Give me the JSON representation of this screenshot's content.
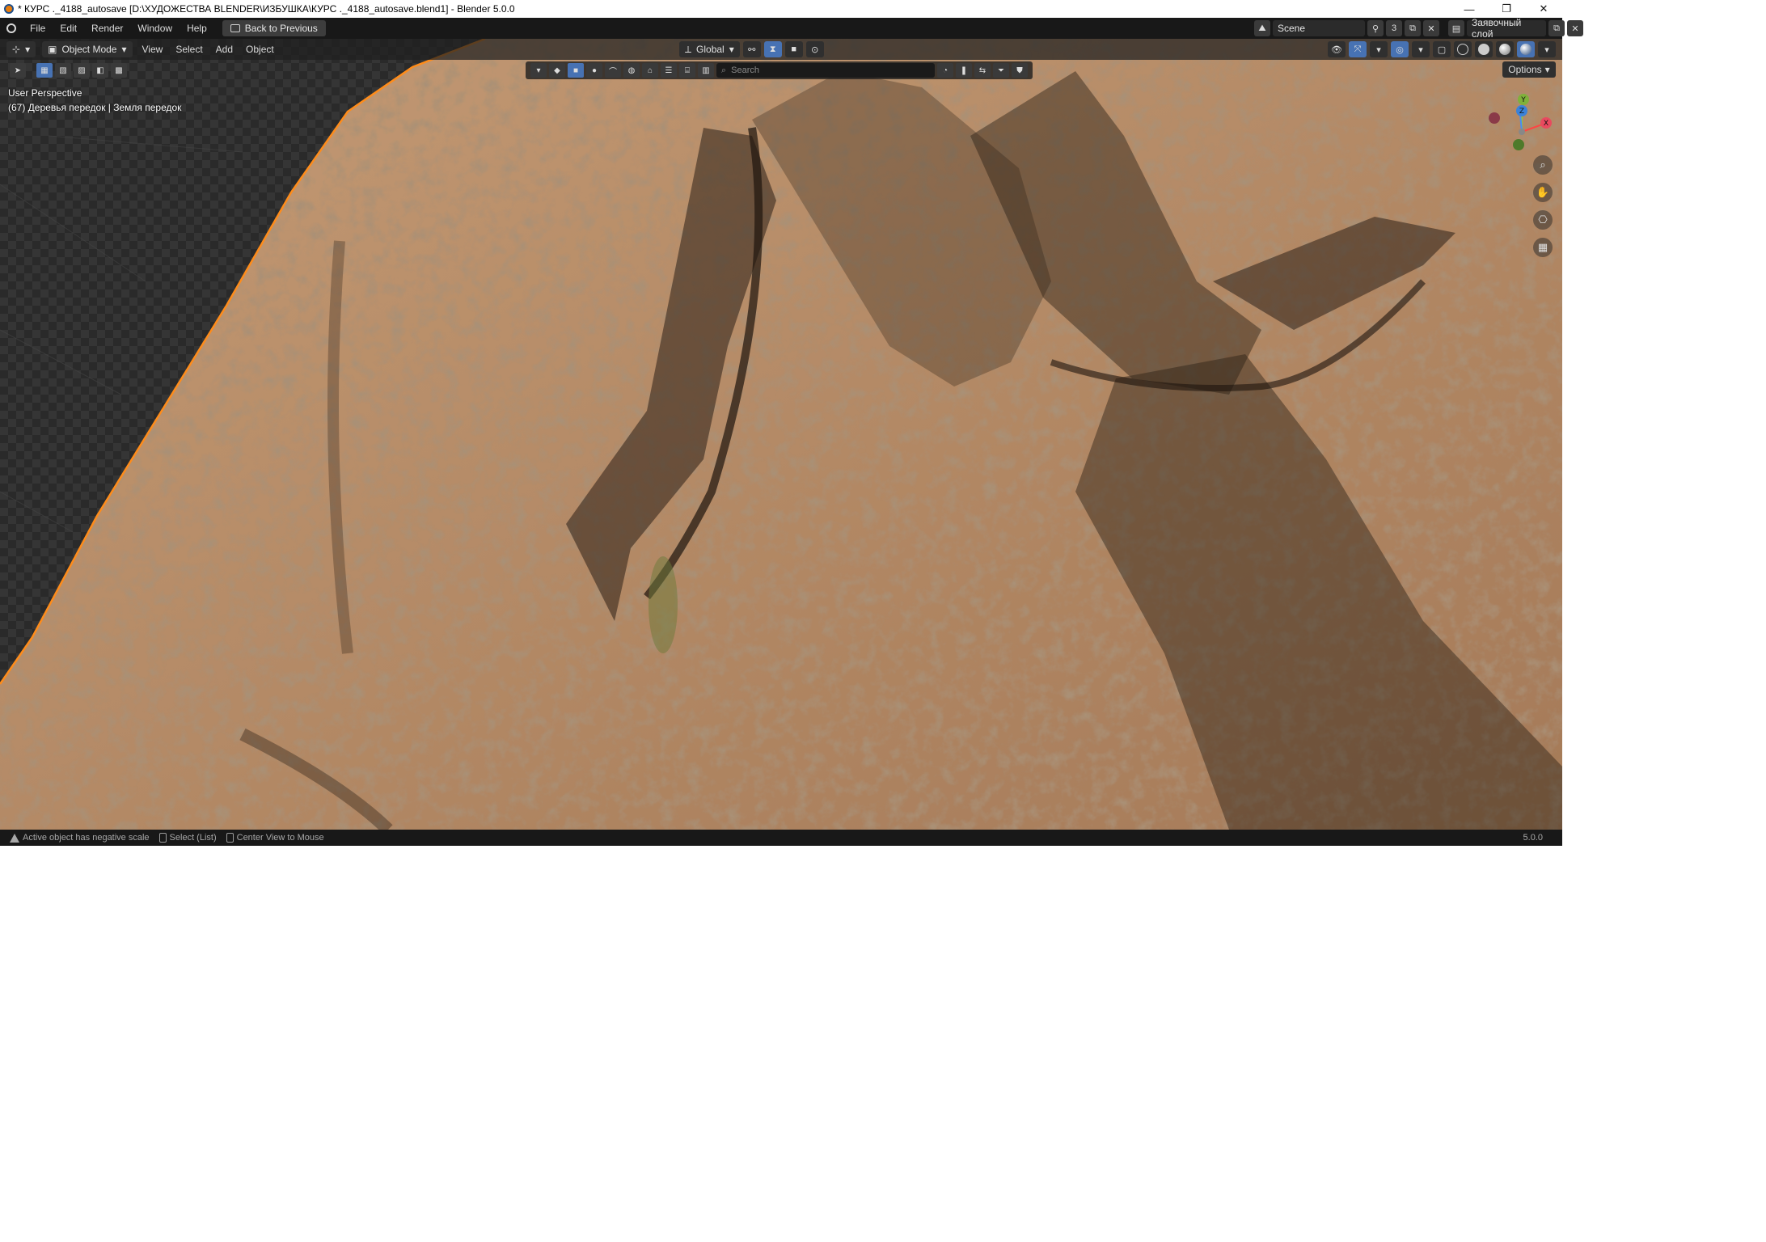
{
  "window": {
    "title": "* КУРС ._4188_autosave [D:\\ХУДОЖЕСТВА BLENDER\\ИЗБУШКА\\КУРС ._4188_autosave.blend1] - Blender 5.0.0",
    "minimize": "—",
    "maximize": "❐",
    "close": "✕"
  },
  "topbar": {
    "menus": [
      "File",
      "Edit",
      "Render",
      "Window",
      "Help"
    ],
    "back_button": "Back to Previous",
    "scene_name": "Scene",
    "scene_users": "3",
    "view_layer": "Заявочный слой"
  },
  "header3d": {
    "mode": "Object Mode",
    "menus": [
      "View",
      "Select",
      "Add",
      "Object"
    ],
    "transform_orientation": "Global"
  },
  "toolrow": {
    "search_placeholder": "Search",
    "options_label": "Options"
  },
  "viewport": {
    "view_name": "User Perspective",
    "object_info": "(67) Деревья передок | Земля передок",
    "gizmo": {
      "x_label": "X",
      "y_label": "Y",
      "z_label": "Z"
    }
  },
  "statusbar": {
    "warning": "Active object has negative scale",
    "hint_select": "Select (List)",
    "hint_center": "Center View to Mouse",
    "version": "5.0.0"
  },
  "colors": {
    "accent": "#4772b3",
    "selection_outline": "#ff8c1a",
    "rock": "#b08460"
  }
}
